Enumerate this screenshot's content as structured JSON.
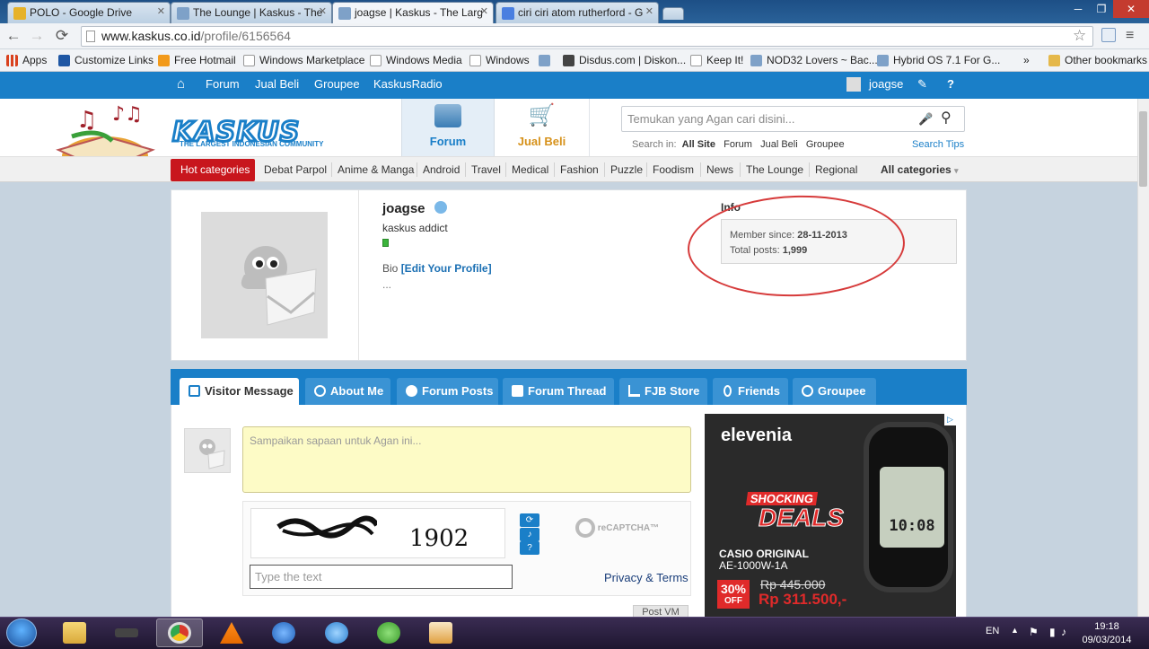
{
  "browser": {
    "tabs": [
      {
        "title": "POLO - Google Drive",
        "favicon_color": "#e6b22a"
      },
      {
        "title": "The Lounge | Kaskus - The",
        "favicon_color": "#7ea1c8"
      },
      {
        "title": "joagse | Kaskus - The Larg",
        "favicon_color": "#7ea1c8"
      },
      {
        "title": "ciri ciri atom rutherford - G",
        "favicon_color": "#4a7fe0"
      }
    ],
    "url_host": "www.kaskus.co.id",
    "url_path": "/profile/6156564",
    "bookmarks": [
      "Apps",
      "Customize Links",
      "Free Hotmail",
      "Windows Marketplace",
      "Windows Media",
      "Windows",
      "Disdus.com | Diskon...",
      "Keep It!",
      "NOD32 Lovers ~ Bac...",
      "Hybrid OS 7.1 For G...",
      "Other bookmarks"
    ],
    "bookmarks_overflow": "»"
  },
  "kaskus": {
    "topnav": [
      "Forum",
      "Jual Beli",
      "Groupee",
      "KaskusRadio"
    ],
    "username": "joagse",
    "logo_text": "KASKUS",
    "logo_sub": "THE LARGEST INDONESIAN COMMUNITY",
    "tab_forum": "Forum",
    "tab_jualbeli": "Jual Beli",
    "search_placeholder": "Temukan yang Agan cari disini...",
    "search_in_label": "Search in:",
    "search_in": [
      "All Site",
      "Forum",
      "Jual Beli",
      "Groupee"
    ],
    "search_tips": "Search Tips",
    "hot_categories": "Hot categories",
    "categories": [
      "Debat Parpol",
      "Anime & Manga",
      "Android",
      "Travel",
      "Medical",
      "Fashion",
      "Puzzle",
      "Foodism",
      "News",
      "The Lounge",
      "Regional"
    ],
    "all_categories": "All categories"
  },
  "profile": {
    "username": "joagse",
    "rank": "kaskus addict",
    "bio_label": "Bio",
    "bio_edit": "[Edit Your Profile]",
    "bio_text": "...",
    "info_heading": "Info",
    "member_since_label": "Member since:",
    "member_since": "28-11-2013",
    "total_posts_label": "Total posts:",
    "total_posts": "1,999"
  },
  "profile_tabs": [
    "Visitor Message",
    "About Me",
    "Forum Posts",
    "Forum Thread",
    "FJB Store",
    "Friends",
    "Groupee"
  ],
  "visitor_message": {
    "placeholder": "Sampaikan sapaan untuk Agan ini...",
    "captcha_text": "1902",
    "captcha_input_placeholder": "Type the text",
    "privacy_terms": "Privacy & Terms",
    "recaptcha_label": "reCAPTCHA™",
    "post_button": "Post VM"
  },
  "ad": {
    "brand": "elevenia",
    "headline_1": "SHOCKING",
    "headline_2": "DEALS",
    "product_1": "CASIO ORIGINAL",
    "product_2": "AE-1000W-1A",
    "discount": "30%",
    "discount_sub": "OFF",
    "old_price": "Rp 445.000",
    "new_price": "Rp 311.500,-",
    "watch_time": "10:08"
  },
  "taskbar": {
    "language": "EN",
    "time": "19:18",
    "date": "09/03/2014"
  }
}
